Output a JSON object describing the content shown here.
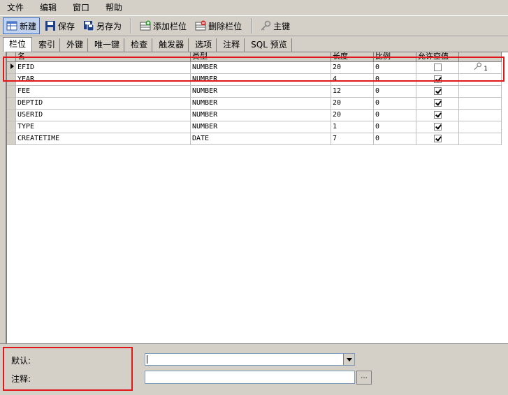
{
  "menu": [
    "文件",
    "编辑",
    "窗口",
    "帮助"
  ],
  "toolbar": {
    "new_label": "新建",
    "save_label": "保存",
    "save_as_label": "另存为",
    "add_field_label": "添加栏位",
    "delete_field_label": "删除栏位",
    "primary_key_label": "主键"
  },
  "tabs": [
    "栏位",
    "索引",
    "外键",
    "唯一键",
    "检查",
    "触发器",
    "选项",
    "注释",
    "SQL 预览"
  ],
  "grid": {
    "headers": [
      "名",
      "类型",
      "长度",
      "比例",
      "允许空值",
      ""
    ],
    "rows": [
      {
        "name": "EFID",
        "type": "NUMBER",
        "length": "20",
        "scale": "0",
        "nullable": false,
        "key": "1"
      },
      {
        "name": "YEAR",
        "type": "NUMBER",
        "length": "4",
        "scale": "0",
        "nullable": true,
        "key": ""
      },
      {
        "name": "FEE",
        "type": "NUMBER",
        "length": "12",
        "scale": "0",
        "nullable": true,
        "key": ""
      },
      {
        "name": "DEPTID",
        "type": "NUMBER",
        "length": "20",
        "scale": "0",
        "nullable": true,
        "key": ""
      },
      {
        "name": "USERID",
        "type": "NUMBER",
        "length": "20",
        "scale": "0",
        "nullable": true,
        "key": ""
      },
      {
        "name": "TYPE",
        "type": "NUMBER",
        "length": "1",
        "scale": "0",
        "nullable": true,
        "key": ""
      },
      {
        "name": "CREATETIME",
        "type": "DATE",
        "length": "7",
        "scale": "0",
        "nullable": true,
        "key": ""
      }
    ]
  },
  "bottom": {
    "default_label": "默认:",
    "default_value": "",
    "comment_label": "注释:",
    "comment_value": "",
    "ellipsis_label": "..."
  },
  "colors": {
    "highlight": "#e0181c",
    "window_bg": "#d4d0c8"
  }
}
